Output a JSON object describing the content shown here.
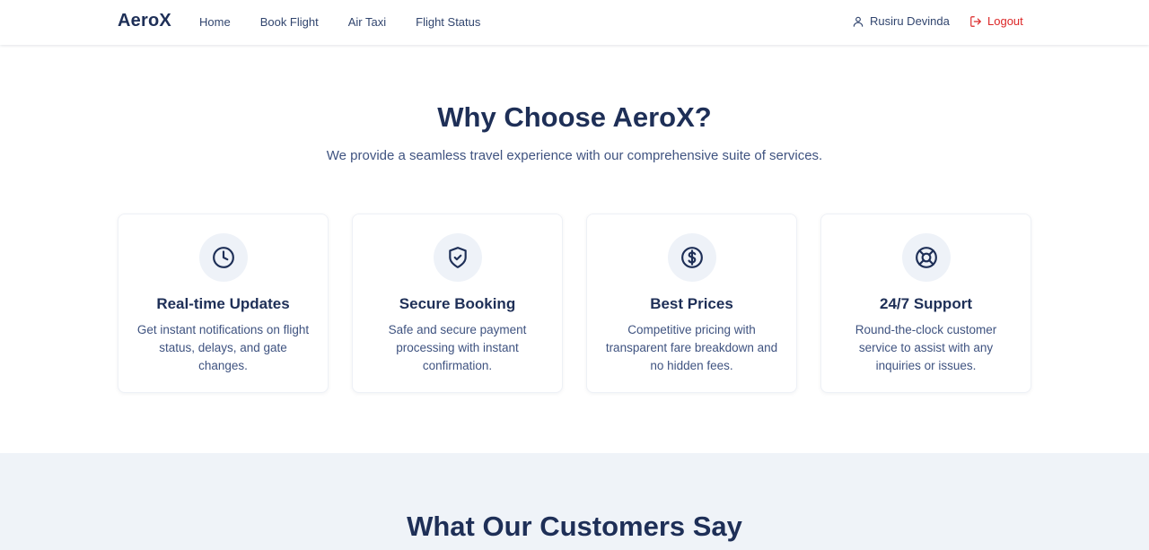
{
  "nav": {
    "brand": "AeroX",
    "links": [
      "Home",
      "Book Flight",
      "Air Taxi",
      "Flight Status"
    ],
    "user_name": "Rusiru Devinda",
    "logout_label": "Logout"
  },
  "why": {
    "title": "Why Choose AeroX?",
    "subtitle": "We provide a seamless travel experience with our comprehensive suite of services.",
    "features": [
      {
        "icon": "clock-icon",
        "title": "Real-time Updates",
        "text": "Get instant notifications on flight status, delays, and gate changes."
      },
      {
        "icon": "shield-check-icon",
        "title": "Secure Booking",
        "text": "Safe and secure payment processing with instant confirmation."
      },
      {
        "icon": "dollar-circle-icon",
        "title": "Best Prices",
        "text": "Competitive pricing with transparent fare breakdown and no hidden fees."
      },
      {
        "icon": "lifebuoy-icon",
        "title": "24/7 Support",
        "text": "Round-the-clock customer service to assist with any inquiries or issues."
      }
    ]
  },
  "testimonials": {
    "title": "What Our Customers Say"
  },
  "colors": {
    "primary": "#1e2f57",
    "text_muted": "#3f5380",
    "logout": "#dc2626",
    "icon_bg": "#eef2f8",
    "section_alt_bg": "#eff3f8"
  }
}
